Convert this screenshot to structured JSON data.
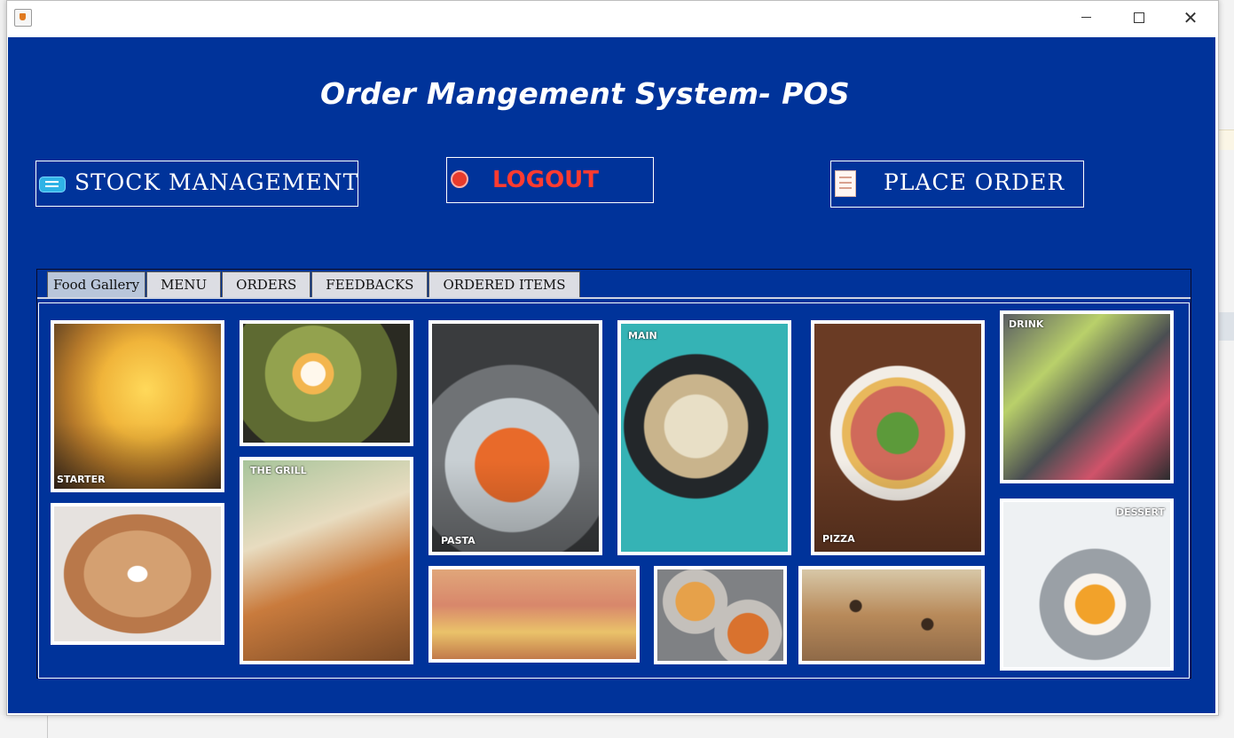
{
  "app": {
    "title": "Order Mangement System- POS"
  },
  "buttons": {
    "stock_management": {
      "label": "STOCK MANAGEMENT",
      "icon": "ticket-icon"
    },
    "logout": {
      "label": "LOGOUT",
      "icon": "record-icon",
      "color": "#ff3b30"
    },
    "place_order": {
      "label": "PLACE ORDER",
      "icon": "receipt-icon"
    }
  },
  "tabs": [
    {
      "label": "Food Gallery",
      "active": true
    },
    {
      "label": "MENU"
    },
    {
      "label": "ORDERS"
    },
    {
      "label": "FEEDBACKS"
    },
    {
      "label": "ORDERED ITEMS"
    }
  ],
  "gallery": {
    "captions": {
      "starter": "STARTER",
      "grill": "THE GRILL",
      "pasta": "PASTA",
      "main": "MAIN",
      "pizza": "PIZZA",
      "drink": "DRINK",
      "dessert": "DESSERT"
    }
  },
  "colors": {
    "background": "#00339a",
    "text": "#ffffff",
    "accent_logout": "#ff3b30"
  }
}
